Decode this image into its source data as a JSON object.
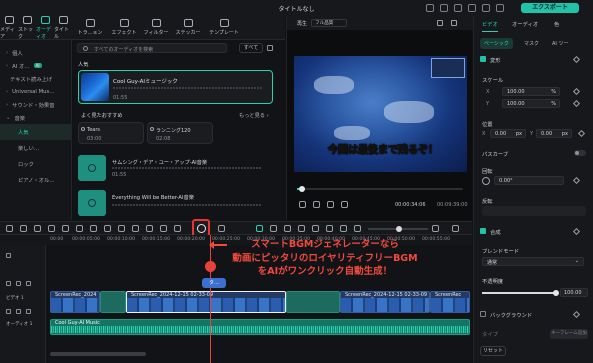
{
  "window": {
    "title": "タイトルなし",
    "export_label": "エクスポート"
  },
  "toolbar": {
    "tools": [
      {
        "label": "メディア",
        "icon": "media-icon"
      },
      {
        "label": "ストック",
        "icon": "stock-icon"
      },
      {
        "label": "オーディオ",
        "icon": "audio-icon",
        "active": true
      },
      {
        "label": "タイトル",
        "icon": "title-icon"
      },
      {
        "label": "トラ...ョン",
        "icon": "transition-icon"
      },
      {
        "label": "エフェクト",
        "icon": "effect-icon"
      },
      {
        "label": "フィルター",
        "icon": "filter-icon"
      },
      {
        "label": "ステッカー",
        "icon": "sticker-icon"
      },
      {
        "label": "テンプレート",
        "icon": "template-icon"
      }
    ]
  },
  "leftnav": {
    "items": [
      {
        "label": "個人",
        "chev": "›"
      },
      {
        "label": "AI オ…",
        "chev": "›",
        "badge": "AI"
      },
      {
        "label": "テキスト読み上げ",
        "chev": ""
      },
      {
        "label": "Universal Mus…",
        "chev": "›"
      },
      {
        "label": "サウンド・効果音",
        "chev": "›"
      },
      {
        "label": "音楽",
        "chev": "⌄"
      },
      {
        "label": "人気",
        "sub": true,
        "selected": true
      },
      {
        "label": "楽しい…",
        "sub": true
      },
      {
        "label": "ロック",
        "sub": true
      },
      {
        "label": "ピアノ・オル…",
        "sub": true
      }
    ]
  },
  "media": {
    "search_placeholder": "すべてのオーディオを検索",
    "all_label": "すべて",
    "section_popular": "人気",
    "featured": {
      "title": "Cool Guy-AIミュージック",
      "duration": "01:55"
    },
    "section_frequent": "よく見たおすすめ",
    "see_more": "もっと見る ›",
    "mini_cards": [
      {
        "name": "Tears",
        "time": "03:00"
      },
      {
        "name": "ランニング120",
        "time": "02:08"
      }
    ],
    "list": [
      {
        "name": "サムシング・デア・ユー・アップ-AI音楽",
        "duration": "01:55"
      },
      {
        "name": "Everything Will be Better-AI音楽",
        "duration": ""
      }
    ]
  },
  "preview": {
    "player_label": "再生",
    "quality": "フル品質",
    "caption": "今回は最後まで残るぞ！",
    "time_current": "00:00:34:06",
    "time_total": "00:09:39:00"
  },
  "inspector": {
    "tabs": [
      "ビデオ",
      "オーディオ",
      "色"
    ],
    "subtabs": [
      "ベーシック",
      "マスク",
      "AI ツー"
    ],
    "transform": "変形",
    "scale": "スケール",
    "scale_x": "100.00",
    "scale_y": "100.00",
    "unit_pct": "%",
    "position": "位置",
    "pos_x": "0.00",
    "pos_y": "0.00",
    "unit_px": "px",
    "path_curve": "パスカーブ",
    "rotate": "回転",
    "rotate_val": "0.00°",
    "flip": "反転",
    "composite": "合成",
    "blend_mode": "ブレンドモード",
    "blend_val": "通常",
    "opacity": "不透明度",
    "opacity_val": "100.00",
    "opacity_level": 1.0,
    "background": "バックグラウンド",
    "type_label": "タイプ",
    "keyframe_label": "キーフレーム追加",
    "reset": "リセット"
  },
  "timeline": {
    "ruler": [
      "00:00",
      "00:00:05:00",
      "00:00:10:00",
      "00:00:15:00",
      "00:00:20:00",
      "00:00:25:00",
      "00:00:30:00",
      "00:00:35:00",
      "00:00:40:00",
      "00:00:45:00",
      "00:00:50:00",
      "00:00:55:00",
      "00:01:00:00"
    ],
    "track_video": "ビデオ 1",
    "track_audio": "オーディオ 1",
    "tip": "タ…",
    "clips": [
      {
        "name": "ScreenRec_2024"
      },
      {
        "name": "ScreenRec_2024-12-15 02-33-09"
      },
      {
        "name": "ScreenRec_2024-12-15 02-33-09"
      },
      {
        "name": "ScreenRec"
      }
    ],
    "audio_clip": "Cool Guy-AI Music"
  },
  "annotation": {
    "line1": "スマートBGMジェネレーターなら",
    "line2": "動画にピッタリのロイヤリティフリーBGM",
    "line3": "をAIがワンクリック自動生成！"
  },
  "colors": {
    "accent": "#22d3b4",
    "annotation": "#f14a3d",
    "playhead": "#e7433a"
  }
}
